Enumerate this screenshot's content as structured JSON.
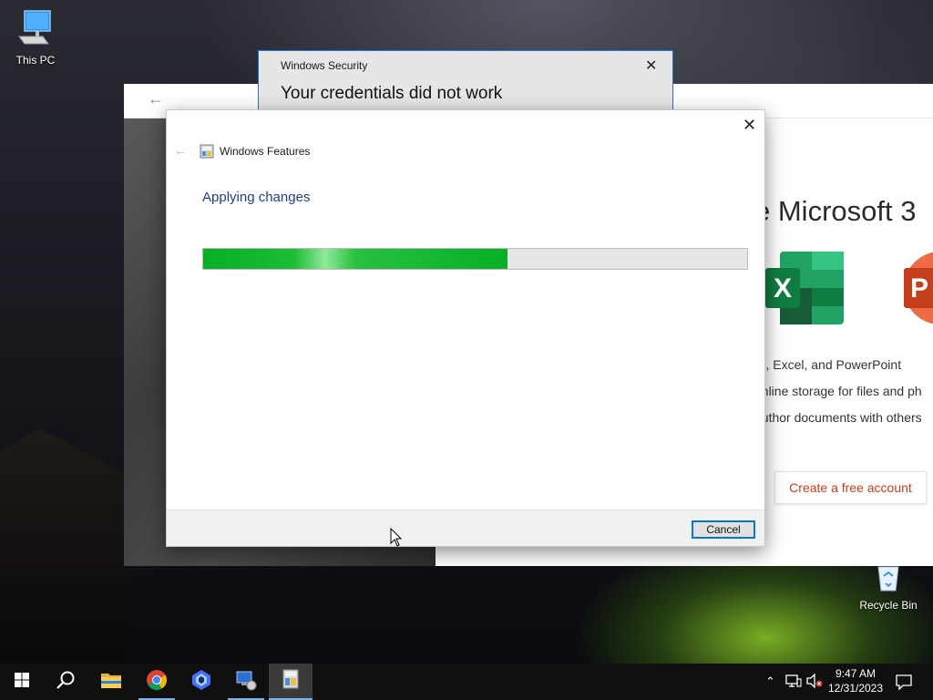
{
  "desktop": {
    "icons": [
      {
        "label": "This PC",
        "icon": "computer-icon"
      },
      {
        "label": "Recycle Bin",
        "icon": "recycle-bin-icon"
      }
    ]
  },
  "office_window": {
    "heading": "e Microsoft 3",
    "lines": [
      "rd, Excel, and PowerPoint",
      "online storage for files and ph",
      "author documents with others"
    ],
    "create_button": "Create a free account",
    "brand_colors": {
      "excel": "#1d6f42",
      "powerpoint": "#c43e1c"
    }
  },
  "security_dialog": {
    "title": "Windows Security",
    "heading": "Your credentials did not work"
  },
  "features_dialog": {
    "title": "Windows Features",
    "status": "Applying changes",
    "progress_percent": 56,
    "cancel_label": "Cancel",
    "accent_color": "#06b025"
  },
  "taskbar": {
    "items": [
      {
        "name": "start-icon"
      },
      {
        "name": "search-icon"
      },
      {
        "name": "file-explorer-icon"
      },
      {
        "name": "chrome-icon"
      },
      {
        "name": "copilot-icon"
      },
      {
        "name": "network-connections-icon"
      },
      {
        "name": "windows-features-icon",
        "active": true
      }
    ],
    "clock": {
      "time": "9:47 AM",
      "date": "12/31/2023"
    }
  }
}
